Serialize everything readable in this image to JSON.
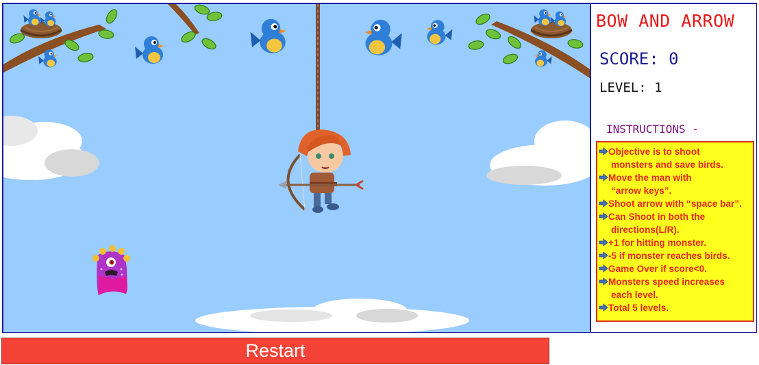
{
  "panel": {
    "title": "BOW AND ARROW",
    "score_text": "SCORE: 0",
    "level_text": "LEVEL: 1",
    "instructions_heading": "INSTRUCTIONS -",
    "instructions": [
      {
        "line1": "Objective is to shoot",
        "line2": "monsters and save birds."
      },
      {
        "line1": "Move the man with",
        "line2": "“arrow keys”."
      },
      {
        "line1": "Shoot arrow with “space bar”.",
        "line2": ""
      },
      {
        "line1": "Can Shoot in both the",
        "line2": "directions(L/R)."
      },
      {
        "line1": "+1 for hitting monster.",
        "line2": ""
      },
      {
        "line1": "-5 if monster reaches birds.",
        "line2": ""
      },
      {
        "line1": "Game Over if score<0.",
        "line2": ""
      },
      {
        "line1": "Monsters speed increases",
        "line2": "each level."
      },
      {
        "line1": "Total 5 levels.",
        "line2": ""
      }
    ]
  },
  "restart_label": "Restart",
  "colors": {
    "sky": "#99ccff",
    "frame_border": "#1d1aa0",
    "title": "#e81818",
    "score": "#1a1a8c",
    "instructions_bg": "#ffff1e",
    "instructions_text": "#e8281c",
    "restart_bg": "#f44336",
    "bird_blue": "#2f7fd8",
    "monster": "#b033c8"
  },
  "sprites": {
    "archer": "archer-sprite",
    "monster": "monster-sprite",
    "birds": "bird-sprite",
    "nests": "nest-sprite"
  }
}
